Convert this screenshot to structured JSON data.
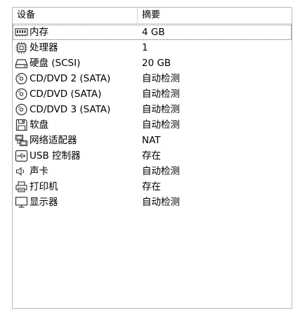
{
  "table": {
    "columns": {
      "device": "设备",
      "summary": "摘要"
    },
    "rows": [
      {
        "icon": "memory-icon",
        "name": "内存",
        "summary": "4 GB"
      },
      {
        "icon": "processor-icon",
        "name": "处理器",
        "summary": "1"
      },
      {
        "icon": "hard-disk-icon",
        "name": "硬盘 (SCSI)",
        "summary": "20 GB"
      },
      {
        "icon": "cd-dvd-icon",
        "name": "CD/DVD 2 (SATA)",
        "summary": "自动检测"
      },
      {
        "icon": "cd-dvd-icon",
        "name": "CD/DVD (SATA)",
        "summary": "自动检测"
      },
      {
        "icon": "cd-dvd-icon",
        "name": "CD/DVD 3 (SATA)",
        "summary": "自动检测"
      },
      {
        "icon": "floppy-icon",
        "name": "软盘",
        "summary": "自动检测"
      },
      {
        "icon": "network-adapter-icon",
        "name": "网络适配器",
        "summary": "NAT"
      },
      {
        "icon": "usb-controller-icon",
        "name": "USB 控制器",
        "summary": "存在"
      },
      {
        "icon": "sound-card-icon",
        "name": "声卡",
        "summary": "自动检测"
      },
      {
        "icon": "printer-icon",
        "name": "打印机",
        "summary": "存在"
      },
      {
        "icon": "display-icon",
        "name": "显示器",
        "summary": "自动检测"
      }
    ]
  }
}
